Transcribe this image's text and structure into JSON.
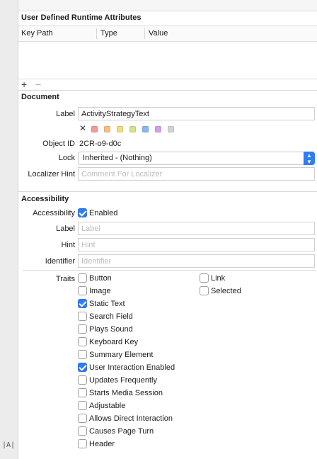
{
  "runtime_attributes": {
    "section_title": "User Defined Runtime Attributes",
    "columns": [
      "Key Path",
      "Type",
      "Value"
    ],
    "add_symbol": "+",
    "remove_symbol": "−"
  },
  "document": {
    "section_title": "Document",
    "label_label": "Label",
    "label_value": "ActivityStrategyText",
    "clear_symbol": "✕",
    "swatch_colors": [
      "#f29a9a",
      "#f7c27e",
      "#f2df7c",
      "#cfe58a",
      "#8ab8f2",
      "#d2a2ee",
      "#d4d4d4"
    ],
    "object_id_label": "Object ID",
    "object_id_value": "2CR-o9-d0c",
    "lock_label": "Lock",
    "lock_value": "Inherited - (Nothing)",
    "localizer_label": "Localizer Hint",
    "localizer_placeholder": "Comment For Localizer"
  },
  "accessibility": {
    "section_title": "Accessibility",
    "accessibility_label": "Accessibility",
    "enabled_label": "Enabled",
    "enabled_checked": true,
    "label_label": "Label",
    "label_placeholder": "Label",
    "hint_label": "Hint",
    "hint_placeholder": "Hint",
    "identifier_label": "Identifier",
    "identifier_placeholder": "Identifier",
    "traits_label": "Traits",
    "traits_left": [
      {
        "label": "Button",
        "checked": false
      },
      {
        "label": "Image",
        "checked": false
      },
      {
        "label": "Static Text",
        "checked": true
      },
      {
        "label": "Search Field",
        "checked": false
      },
      {
        "label": "Plays Sound",
        "checked": false
      },
      {
        "label": "Keyboard Key",
        "checked": false
      },
      {
        "label": "Summary Element",
        "checked": false
      },
      {
        "label": "User Interaction Enabled",
        "checked": true
      },
      {
        "label": "Updates Frequently",
        "checked": false
      },
      {
        "label": "Starts Media Session",
        "checked": false
      },
      {
        "label": "Adjustable",
        "checked": false
      },
      {
        "label": "Allows Direct Interaction",
        "checked": false
      },
      {
        "label": "Causes Page Turn",
        "checked": false
      },
      {
        "label": "Header",
        "checked": false
      }
    ],
    "traits_right": [
      {
        "label": "Link",
        "checked": false
      },
      {
        "label": "Selected",
        "checked": false
      }
    ]
  },
  "sidebar": {
    "bottom_icon_text": "|A|"
  },
  "colors": {
    "accent": "#2f7cf6"
  }
}
